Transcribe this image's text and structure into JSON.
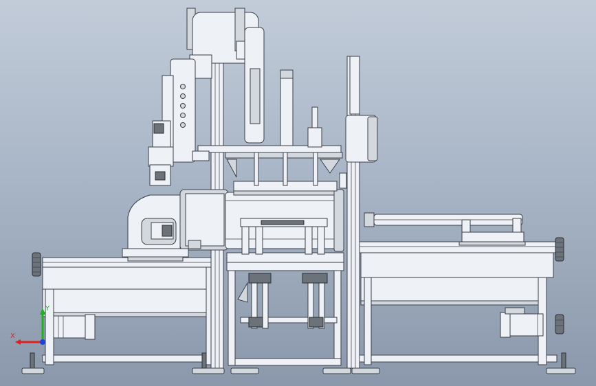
{
  "view": {
    "background_top": "#c2ccd9",
    "background_bottom": "#8b98ab"
  },
  "triad": {
    "x_label": "X",
    "y_label": "Y",
    "x_color": "#e02020",
    "y_color": "#20b020",
    "z_color": "#2040e0"
  }
}
